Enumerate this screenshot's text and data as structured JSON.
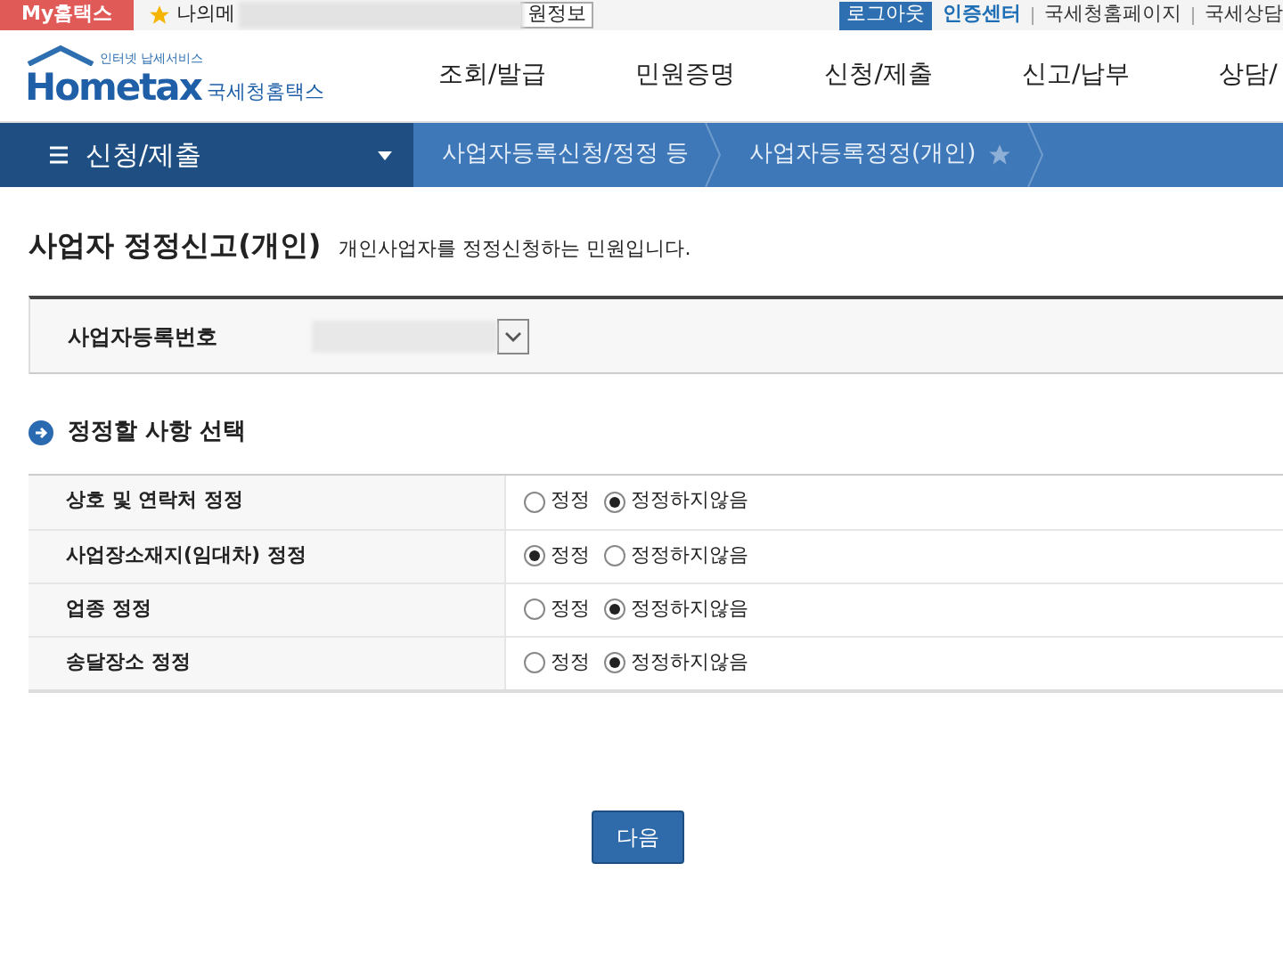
{
  "top_bar": {
    "my_tab": "My홈택스",
    "my_menu_start": "나의메",
    "member_info": "원정보",
    "logout": "로그아웃",
    "links": [
      {
        "label": "인증센터",
        "kind": "strong"
      },
      {
        "label": "국세청홈페이지",
        "kind": "plain"
      },
      {
        "label": "국세상담",
        "kind": "plain"
      }
    ]
  },
  "logo": {
    "wordmark": "Hometax",
    "tagline": "인터넷 납세서비스",
    "name": "국세청홈택스"
  },
  "main_nav": [
    "조회/발급",
    "민원증명",
    "신청/제출",
    "신고/납부",
    "상담/"
  ],
  "breadcrumb": {
    "menu": "신청/제출",
    "steps": [
      "사업자등록신청/정정 등",
      "사업자등록정정(개인)"
    ]
  },
  "page": {
    "title": "사업자 정정신고(개인)",
    "description": "개인사업자를 정정신청하는 민원입니다."
  },
  "registration": {
    "label": "사업자등록번호"
  },
  "section_title": "정정할 사항 선택",
  "items": [
    {
      "label": "상호 및 연락처 정정",
      "options": [
        {
          "label": "정정",
          "selected": false
        },
        {
          "label": "정정하지않음",
          "selected": true
        }
      ]
    },
    {
      "label": "사업장소재지(임대차) 정정",
      "options": [
        {
          "label": "정정",
          "selected": true
        },
        {
          "label": "정정하지않음",
          "selected": false
        }
      ]
    },
    {
      "label": "업종 정정",
      "options": [
        {
          "label": "정정",
          "selected": false
        },
        {
          "label": "정정하지않음",
          "selected": true
        }
      ]
    },
    {
      "label": "송달장소 정정",
      "options": [
        {
          "label": "정정",
          "selected": false
        },
        {
          "label": "정정하지않음",
          "selected": true
        }
      ]
    }
  ],
  "next_button": "다음"
}
